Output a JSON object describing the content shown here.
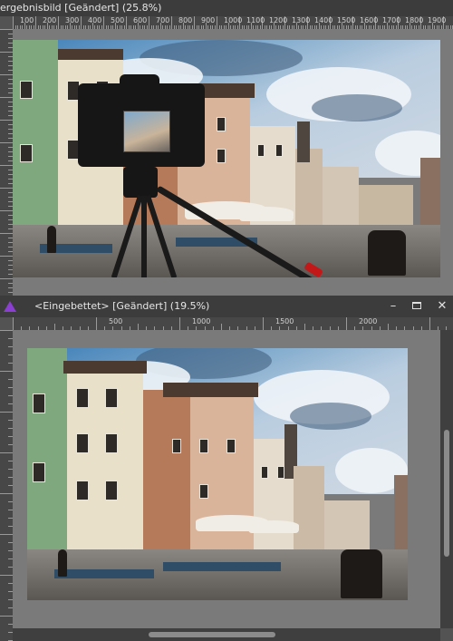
{
  "window_top": {
    "title": "ergebnisbild [Geändert] (25.8%)",
    "ruler_labels": [
      "100",
      "200",
      "300",
      "400",
      "500",
      "600",
      "700",
      "800",
      "900",
      "1000",
      "1100",
      "1200",
      "1300",
      "1400",
      "1500",
      "1600",
      "1700",
      "1800",
      "1900"
    ]
  },
  "window_bottom": {
    "title": "<Eingebettet> [Geändert] (19.5%)",
    "ruler_labels": [
      "500",
      "1000",
      "1500",
      "2000"
    ],
    "minimize": "–",
    "maximize": "□",
    "close": "✕"
  },
  "colors": {
    "app_bg": "#535353",
    "titlebar": "#3c3c3c",
    "ruler": "#474747",
    "canvas": "#7a7a7a",
    "accent_icon": "#8a3fd1"
  },
  "icons": [
    "affinity-photo-icon",
    "minimize-icon",
    "maximize-icon",
    "close-icon"
  ]
}
